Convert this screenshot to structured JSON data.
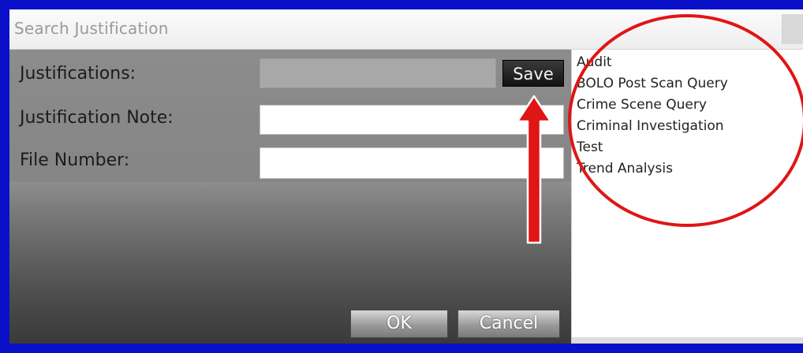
{
  "dialog": {
    "title": "Search Justification"
  },
  "form": {
    "justifications_label": "Justifications:",
    "justification_note_label": "Justification Note:",
    "file_number_label": "File Number:",
    "justifications_value": "",
    "justification_note_value": "",
    "file_number_value": "",
    "save_label": "Save"
  },
  "buttons": {
    "ok_label": "OK",
    "cancel_label": "Cancel"
  },
  "justification_list": {
    "items": [
      "Audit",
      "BOLO Post Scan Query",
      "Crime Scene Query",
      "Criminal Investigation",
      "Test",
      "Trend Analysis"
    ]
  },
  "annotations": {
    "highlight_color": "#e01515"
  },
  "colors": {
    "desktop_background": "#0a10c8",
    "form_background": "#8e8e8e",
    "save_button": "#1a1a1a"
  },
  "icons": {
    "circle": "annotation-circle-icon",
    "arrow": "annotation-arrow-icon"
  }
}
